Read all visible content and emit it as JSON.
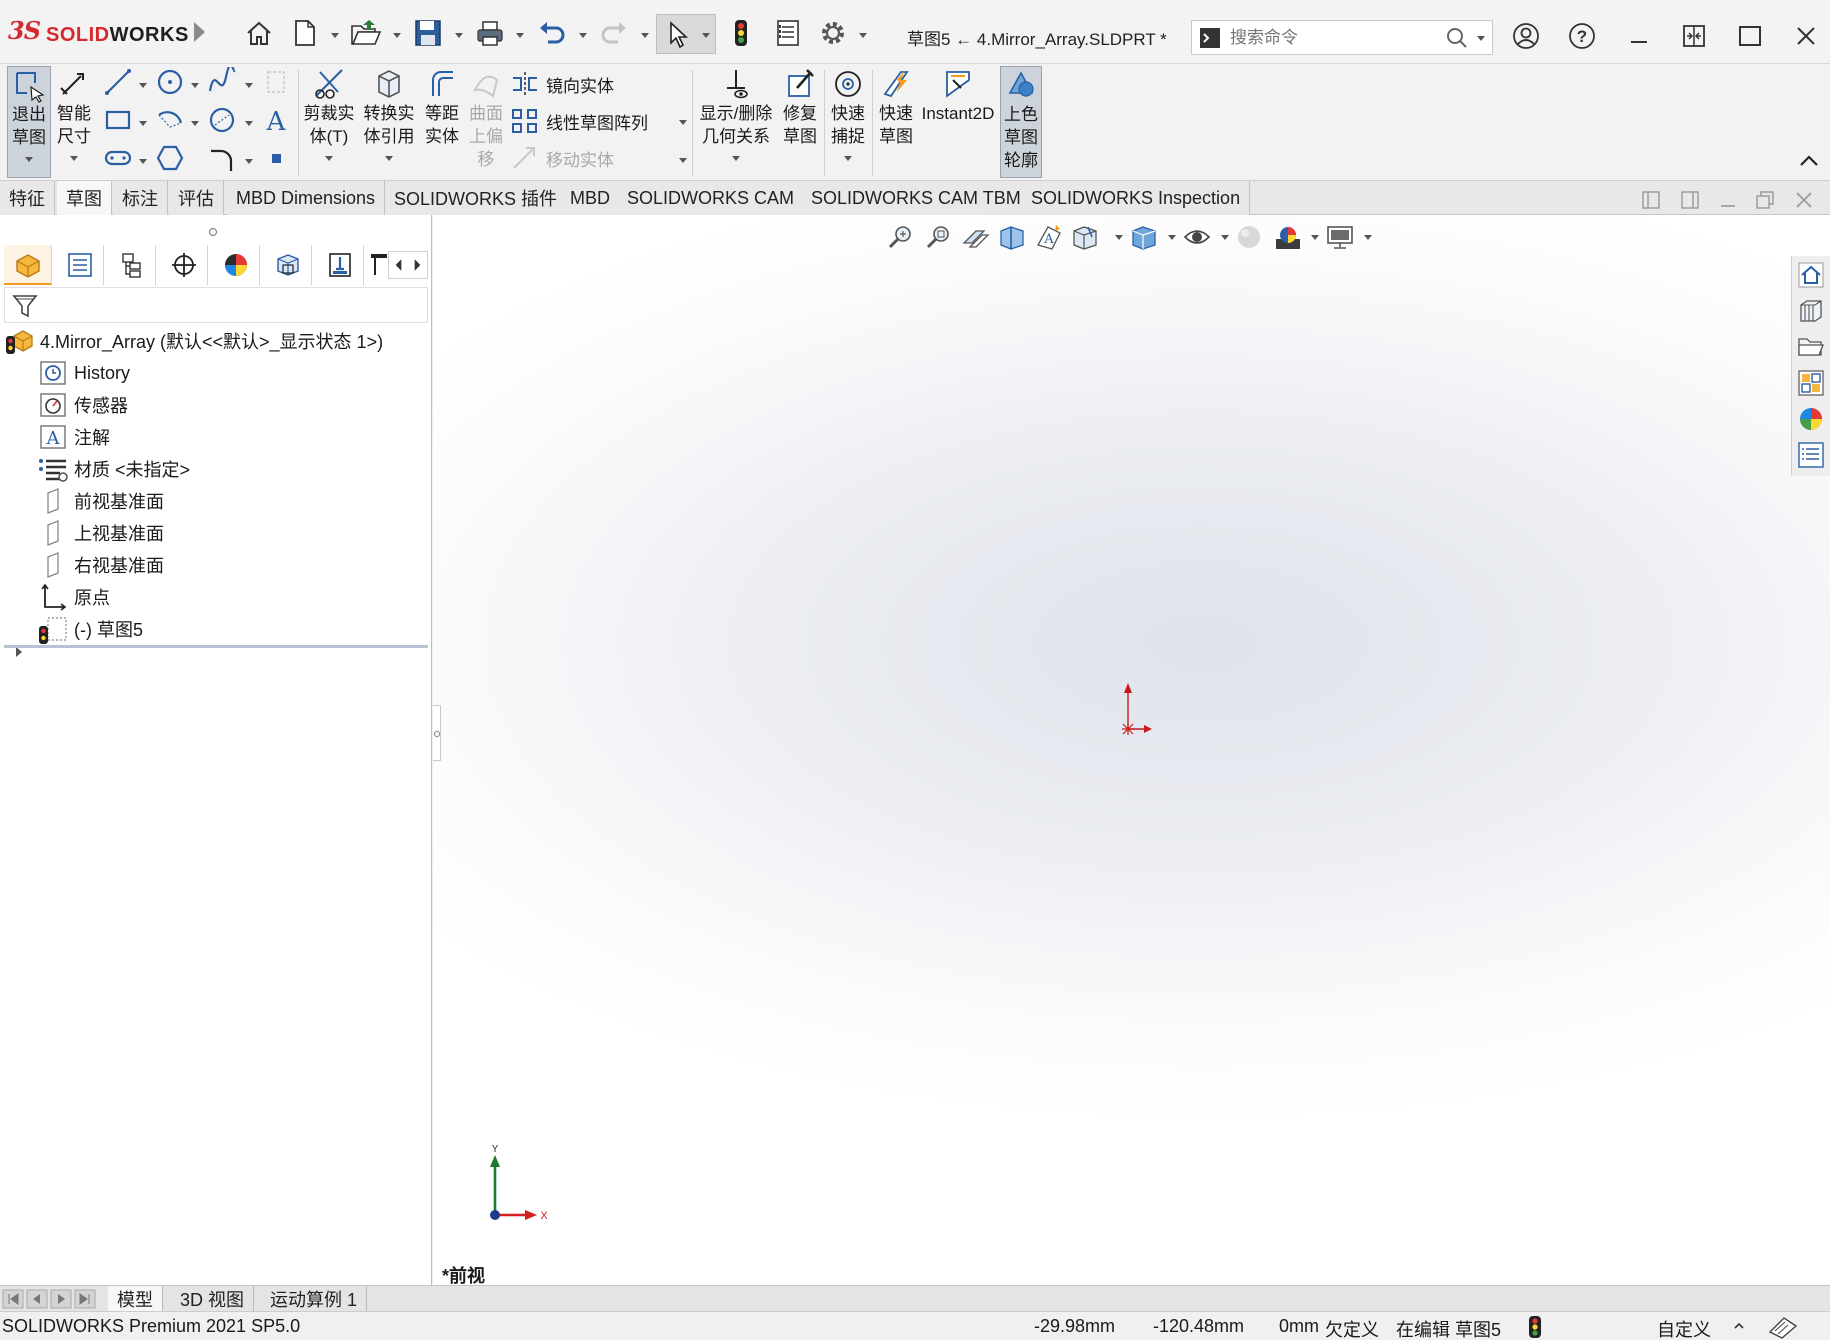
{
  "titlebar": {
    "logo_mark": "3S",
    "logo_word_a": "SOLID",
    "logo_word_b": "WORKS",
    "doc_title": "草图5 ← 4.Mirror_Array.SLDPRT *",
    "search_placeholder": "搜索命令",
    "quick_access": [
      "home-icon",
      "new-file-icon",
      "open-file-icon",
      "save-icon",
      "print-icon",
      "undo-icon",
      "redo-icon",
      "select-icon",
      "rebuild-icon",
      "file-properties-icon",
      "options-icon"
    ],
    "window_controls": [
      "user-icon",
      "help-icon",
      "minimize-icon",
      "restore-icon",
      "maximize-icon",
      "close-icon"
    ]
  },
  "ribbon": {
    "exit_sketch": "退出\n草图",
    "smart_dimension": "智能\n尺寸",
    "trim": "剪裁实\n体(T)",
    "convert": "转换实\n体引用",
    "offset": "等距\n实体",
    "surface_offset": "曲面\n上偏\n移",
    "mirror": "镜向实体",
    "linear_pattern": "线性草图阵列",
    "move": "移动实体",
    "display_relations": "显示/删除\n几何关系",
    "repair": "修复\n草图",
    "quick_snap": "快速\n捕捉",
    "rapid_sketch": "快速\n草图",
    "instant2d": "Instant2D",
    "shaded_contours": "上色\n草图\n轮廓"
  },
  "tabs": [
    {
      "label": "特征",
      "active": false
    },
    {
      "label": "草图",
      "active": true
    },
    {
      "label": "标注",
      "active": false
    },
    {
      "label": "评估",
      "active": false
    },
    {
      "label": "MBD Dimensions",
      "active": false
    },
    {
      "label": "SOLIDWORKS 插件",
      "active": false
    },
    {
      "label": "MBD",
      "active": false
    },
    {
      "label": "SOLIDWORKS CAM",
      "active": false
    },
    {
      "label": "SOLIDWORKS CAM TBM",
      "active": false
    },
    {
      "label": "SOLIDWORKS Inspection",
      "active": false
    }
  ],
  "tree": {
    "root": "4.Mirror_Array  (默认<<默认>_显示状态 1>)",
    "items": [
      {
        "label": "History",
        "icon": "history-icon"
      },
      {
        "label": "传感器",
        "icon": "sensor-icon"
      },
      {
        "label": "注解",
        "icon": "annotation-icon"
      },
      {
        "label": "材质 <未指定>",
        "icon": "material-icon"
      },
      {
        "label": "前视基准面",
        "icon": "plane-icon"
      },
      {
        "label": "上视基准面",
        "icon": "plane-icon"
      },
      {
        "label": "右视基准面",
        "icon": "plane-icon"
      },
      {
        "label": "原点",
        "icon": "origin-icon"
      },
      {
        "label": "(-) 草图5",
        "icon": "sketch-icon"
      }
    ]
  },
  "viewport": {
    "view_label": "*前视",
    "triad_x": "X",
    "triad_y": "Y"
  },
  "bottom_tabs": [
    {
      "label": "模型",
      "active": true
    },
    {
      "label": "3D 视图",
      "active": false
    },
    {
      "label": "运动算例 1",
      "active": false
    }
  ],
  "status": {
    "product": "SOLIDWORKS Premium 2021 SP5.0",
    "x": "-29.98mm",
    "y": "-120.48mm",
    "z": "0mm",
    "definition": "欠定义",
    "editing": "在编辑 草图5",
    "units": "自定义"
  },
  "colors": {
    "brand_red": "#d6292e",
    "origin_red": "#cc1a1a",
    "axis_green": "#1f7a2c",
    "axis_red": "#d42020",
    "axis_blue": "#1d3b8f"
  }
}
